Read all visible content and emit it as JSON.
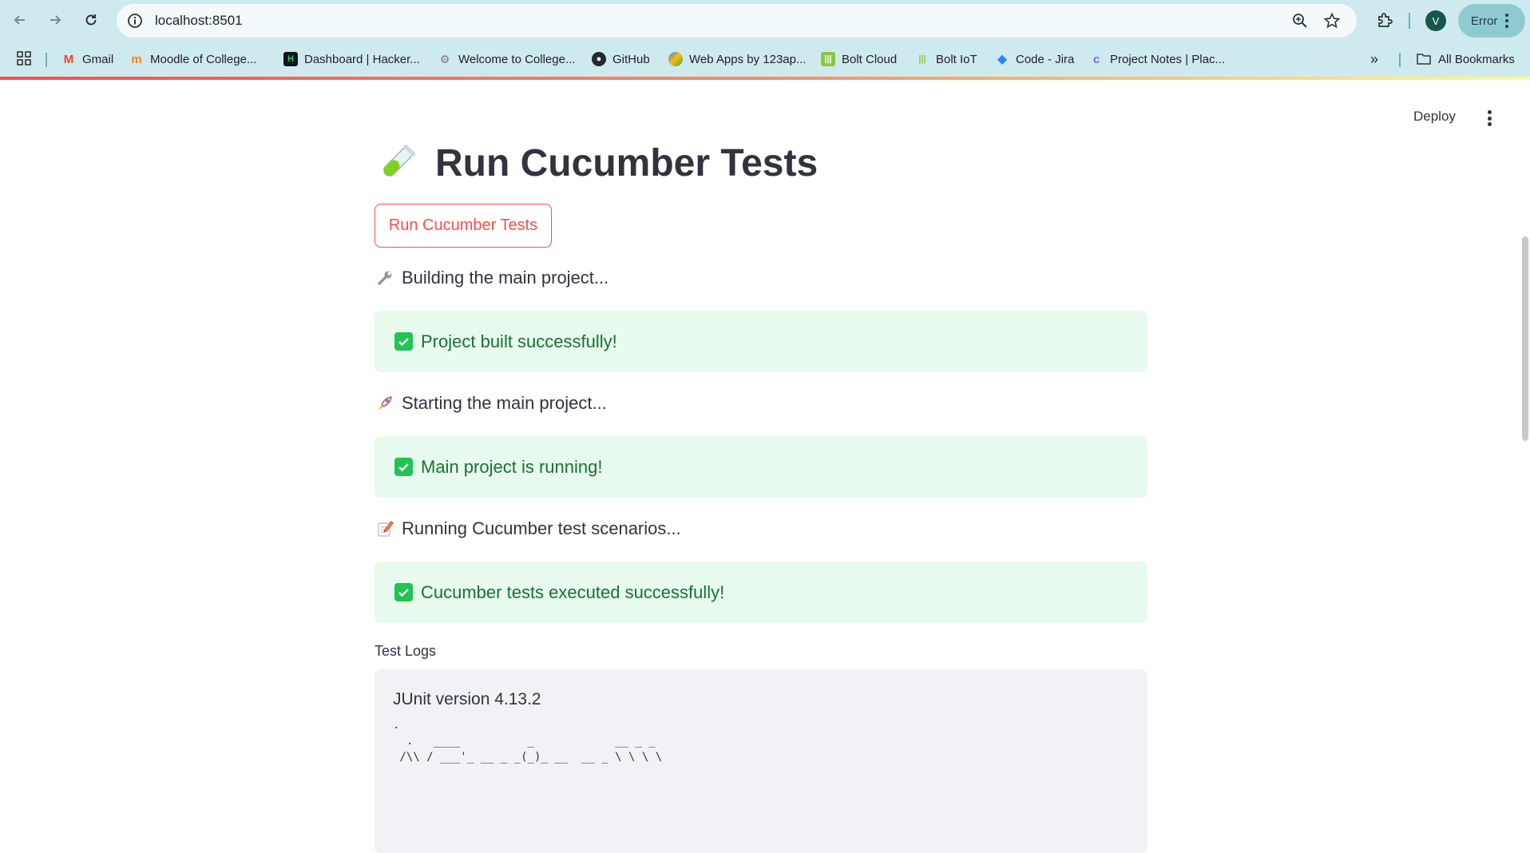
{
  "browser": {
    "url": "localhost:8501",
    "profile_initial": "V",
    "error_label": "Error",
    "bookmarks": [
      {
        "label": "Gmail",
        "icon": "gmail-icon"
      },
      {
        "label": "Moodle of College...",
        "icon": "moodle-icon"
      },
      {
        "label": "Dashboard | Hacker...",
        "icon": "hackerrank-icon"
      },
      {
        "label": "Welcome to College...",
        "icon": "college-icon"
      },
      {
        "label": "GitHub",
        "icon": "github-icon"
      },
      {
        "label": "Web Apps by 123ap...",
        "icon": "webapps-icon"
      },
      {
        "label": "Bolt Cloud",
        "icon": "bolt-cloud-icon"
      },
      {
        "label": "Bolt IoT",
        "icon": "bolt-iot-icon"
      },
      {
        "label": "Code - Jira",
        "icon": "jira-icon"
      },
      {
        "label": "Project Notes | Plac...",
        "icon": "clickup-icon"
      }
    ],
    "all_bookmarks_label": "All Bookmarks"
  },
  "app": {
    "deploy_label": "Deploy",
    "title": "Run Cucumber Tests",
    "run_button_label": "Run Cucumber Tests",
    "steps": [
      {
        "status_text": "Building the main project...",
        "status_icon": "wrench-icon",
        "success_text": "Project built successfully!"
      },
      {
        "status_text": "Starting the main project...",
        "status_icon": "rocket-icon",
        "success_text": "Main project is running!"
      },
      {
        "status_text": "Running Cucumber test scenarios...",
        "status_icon": "memo-icon",
        "success_text": "Cucumber tests executed successfully!"
      }
    ],
    "logs_label": "Test Logs",
    "logs_first_line": "JUnit version 4.13.2",
    "logs_rest": ".\n  .   ____          _            __ _ _\n /\\\\ / ___'_ __ _ _(_)_ __  __ _ \\ \\ \\ \\"
  },
  "colors": {
    "accent": "#ff4b4b",
    "success_bg": "#e8f9ee",
    "success_text": "#177233",
    "chrome_bg": "#cfeaee"
  }
}
